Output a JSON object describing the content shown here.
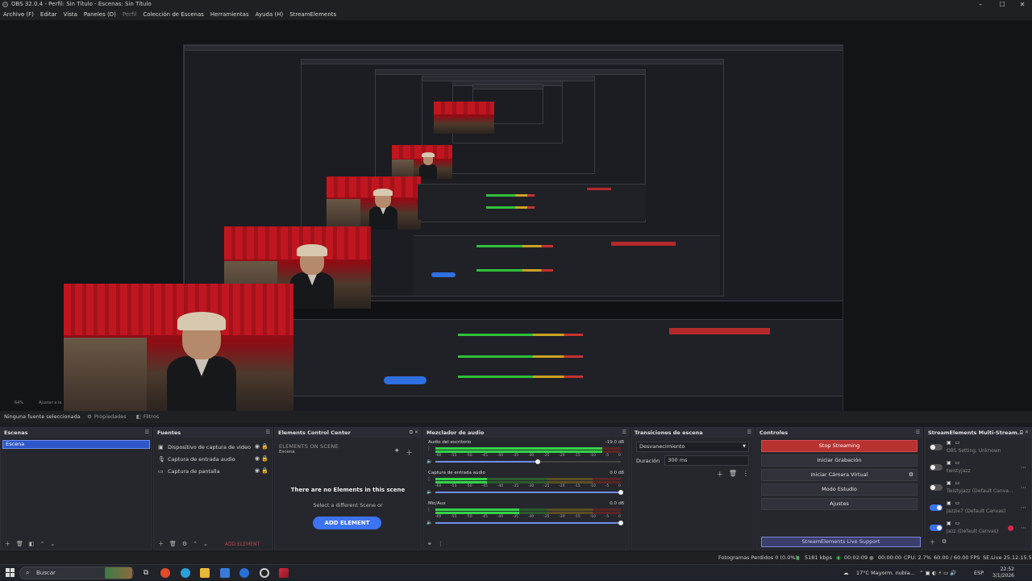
{
  "window": {
    "title": "OBS 32.0.4 - Perfil: Sin Título - Escenas: Sin Título",
    "minimize": "–",
    "maximize": "☐",
    "close": "✕"
  },
  "menu": [
    {
      "label": "Archivo (F)"
    },
    {
      "label": "Editar"
    },
    {
      "label": "Vista"
    },
    {
      "label": "Paneles (D)"
    },
    {
      "label": "Perfil",
      "disabled": true
    },
    {
      "label": "Colección de Escenas"
    },
    {
      "label": "Herramientas"
    },
    {
      "label": "Ayuda (H)"
    },
    {
      "label": "StreamElements"
    }
  ],
  "preview": {
    "zoom_label": "64%",
    "fit_label": "Ajustar a la"
  },
  "source_toolbar": {
    "no_source": "Ninguna fuente seleccionada",
    "properties": "Propiedades",
    "filters": "Filtros"
  },
  "scenes": {
    "title": "Escenas",
    "items": [
      "Escena"
    ],
    "selected": "Escena"
  },
  "sources": {
    "title": "Fuentes",
    "items": [
      {
        "label": "Dispositivo de captura de video",
        "icon": "camera-icon"
      },
      {
        "label": "Captura de entrada audio",
        "icon": "microphone-icon"
      },
      {
        "label": "Captura de pantalla",
        "icon": "monitor-icon"
      }
    ],
    "add_element": "ADD ELEMENT"
  },
  "ecc": {
    "title": "Elements Control Center",
    "on_scene": "ELEMENTS ON SCENE",
    "scene": "Escena",
    "empty": "There are no Elements in this scene",
    "select": "Select a different Scene or",
    "add": "ADD ELEMENT"
  },
  "mixer": {
    "title": "Mezclador de audio",
    "channels": [
      {
        "label": "Audio del escritorio",
        "db": "-19.0 dB",
        "level": 0.9,
        "volume": 0.55
      },
      {
        "label": "Captura de entrada audio",
        "db": "0.0 dB",
        "level": 0.28,
        "volume": 1.0
      },
      {
        "label": "Mic/Aux",
        "db": "0.0 dB",
        "level": 0.45,
        "volume": 1.0
      }
    ],
    "ticks": [
      "-60",
      "-55",
      "-50",
      "-45",
      "-40",
      "-35",
      "-30",
      "-25",
      "-20",
      "-15",
      "-10",
      "-5",
      "0"
    ]
  },
  "transitions": {
    "title": "Transiciones de escena",
    "selected": "Desvanecimiento",
    "duration_label": "Duración",
    "duration": "300 ms"
  },
  "controls": {
    "title": "Controles",
    "stop_streaming": "Stop Streaming",
    "start_recording": "Iniciar Grabación",
    "virtual_camera": "Iniciar Cámara Virtual",
    "studio_mode": "Modo Estudio",
    "settings": "Ajustes",
    "support": "StreamElements Live Support"
  },
  "multistream": {
    "title": "StreamElements Multi-Stream...",
    "rows": [
      {
        "name": "OBS Setting, Unknown",
        "on": false
      },
      {
        "name": "twistyjazz",
        "on": false
      },
      {
        "name": "Twistyjazz (Default Canva...",
        "on": false
      },
      {
        "name": "Jazzie7 (Default Canvas)",
        "on": true
      },
      {
        "name": "Jazz (Default Canvas)",
        "on": true
      }
    ]
  },
  "status": {
    "dropped": "Fotogramas Perdidos 0 (0.0%)",
    "bitrate": "5181 kbps",
    "stream_time": "00:02:09",
    "rec_time": "00:00:00",
    "cpu": "CPU: 2.7%",
    "fps": "60.00 / 60.00 FPS",
    "version": "SE.Live 25.12.15.535"
  },
  "taskbar": {
    "search": "Buscar",
    "weather": "17°C  Mayorm. nubla...",
    "lang": "ESP",
    "time": "22:52",
    "date": "3/1/2026"
  }
}
